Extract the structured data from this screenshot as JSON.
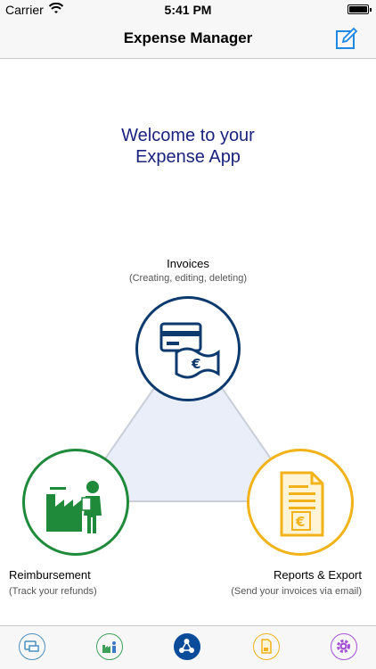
{
  "status": {
    "carrier": "Carrier",
    "time": "5:41 PM"
  },
  "nav": {
    "title": "Expense Manager",
    "compose_icon": "compose-icon"
  },
  "welcome": {
    "line1": "Welcome to your",
    "line2": "Expense App"
  },
  "invoices": {
    "label": "Invoices",
    "sublabel": "(Creating, editing, deleting)",
    "icon": "credit-card-cash-icon",
    "color": "#0d3a6e"
  },
  "reimbursement": {
    "label": "Reimbursement",
    "sublabel": "(Track your refunds)",
    "icon": "factory-person-icon",
    "color": "#1f8a3a"
  },
  "reports": {
    "label": "Reports & Export",
    "sublabel": "(Send your invoices via email)",
    "icon": "euro-document-icon",
    "color": "#f2b21a"
  },
  "tabs": [
    {
      "name": "invoices-tab",
      "icon": "card-icon",
      "color": "#4a90c2"
    },
    {
      "name": "reimbursement-tab",
      "icon": "person-factory-icon",
      "color": "#3aa05a"
    },
    {
      "name": "home-tab",
      "icon": "hub-icon",
      "color": "#0a4c9a",
      "active": true
    },
    {
      "name": "reports-tab",
      "icon": "document-icon",
      "color": "#f2b21a"
    },
    {
      "name": "settings-tab",
      "icon": "gear-icon",
      "color": "#a450d6"
    }
  ]
}
